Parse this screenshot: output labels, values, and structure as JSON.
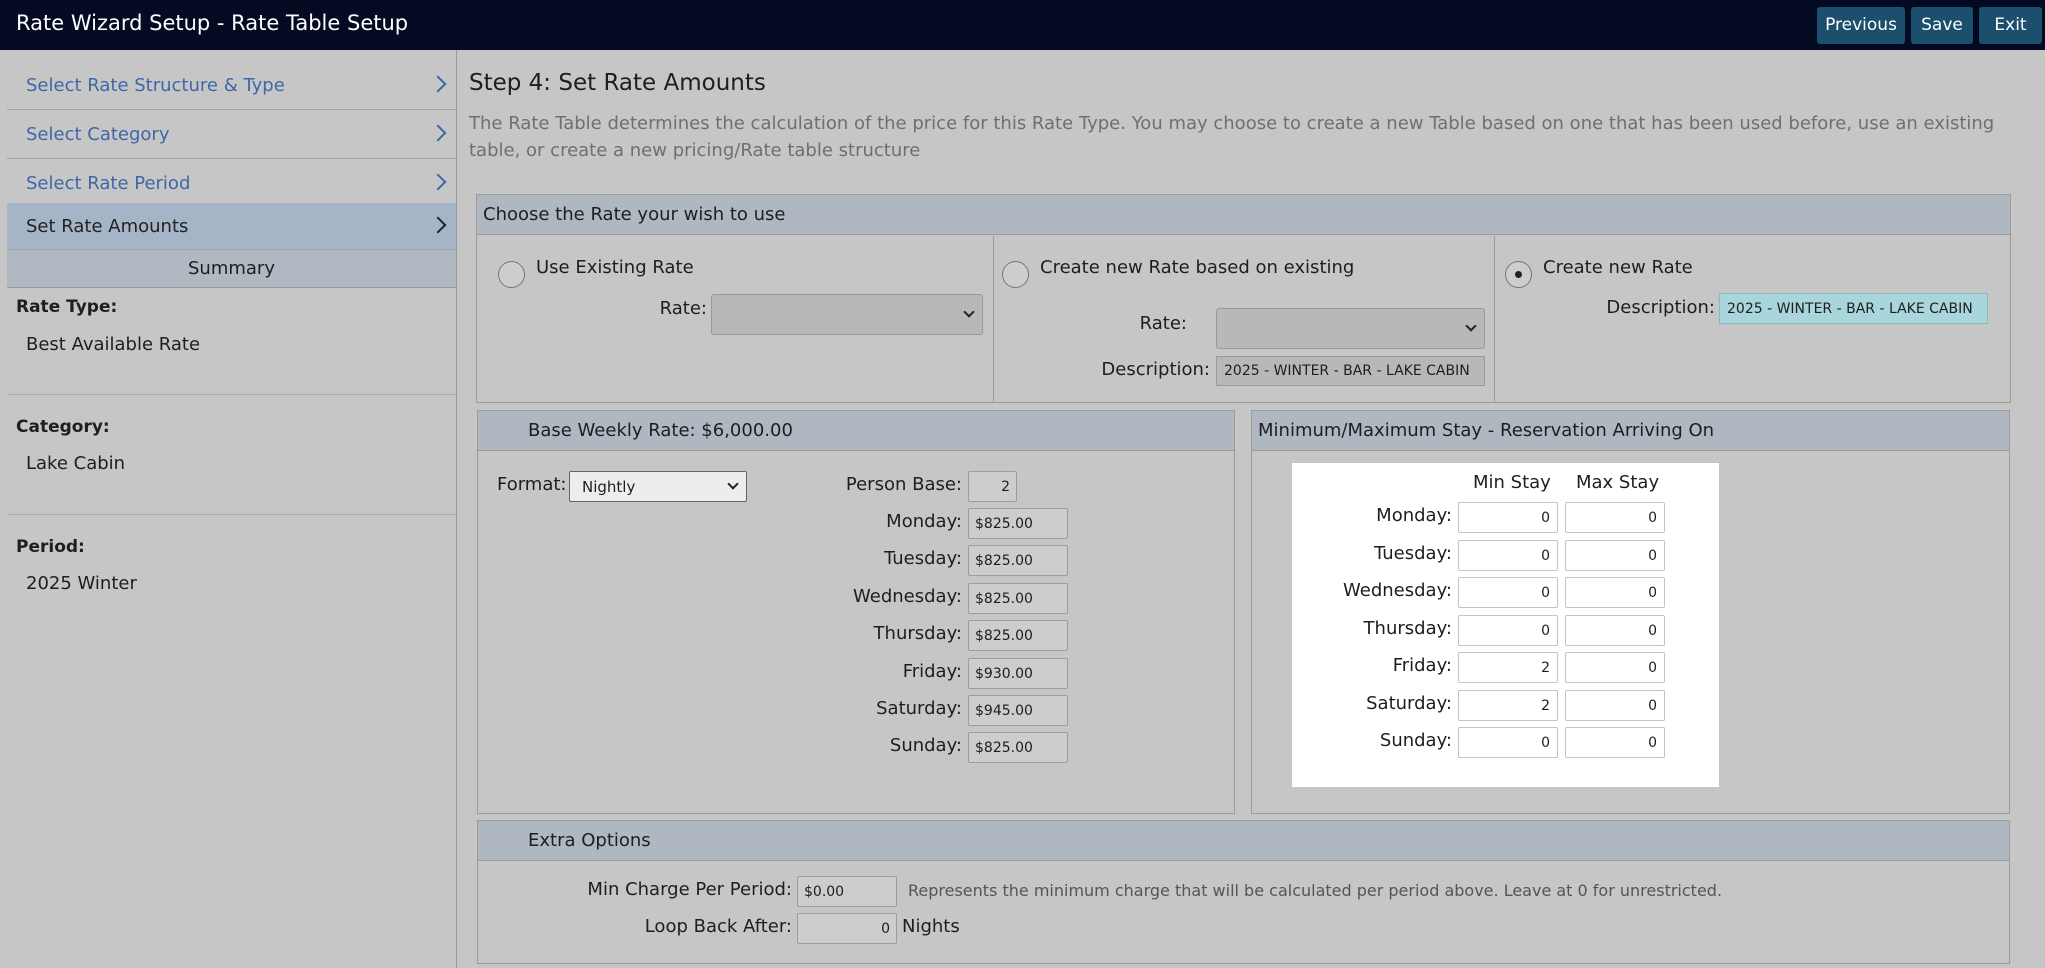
{
  "app": {
    "title": "Rate Wizard Setup - Rate Table Setup",
    "buttons": {
      "previous": "Previous",
      "save": "Save",
      "exit": "Exit"
    },
    "colors": {
      "topbar": "#030a22",
      "button": "#1c4f6e",
      "link": "#3e67a8",
      "active_step": "#a6b4c8",
      "panel_header": "#afb7c1",
      "description_field": "#a9d6dc"
    }
  },
  "sidebar": {
    "steps": [
      {
        "label": "Select Rate Structure & Type",
        "icon": "chevron-right-icon"
      },
      {
        "label": "Select Category",
        "icon": "chevron-right-icon"
      },
      {
        "label": "Select Rate Period",
        "icon": "chevron-right-icon"
      },
      {
        "label": "Set Rate Amounts",
        "icon": "chevron-right-icon",
        "active": true
      }
    ],
    "summary_title": "Summary",
    "rate_type_label": "Rate Type:",
    "rate_type_value": "Best Available Rate",
    "category_label": "Category:",
    "category_value": "Lake Cabin",
    "period_label": "Period:",
    "period_value": "2025 Winter"
  },
  "main": {
    "heading": "Step 4: Set Rate Amounts",
    "intro": "The Rate Table determines the calculation of the price for this Rate Type. You may choose to create a new Table based on one that has been used before, use an existing table, or create a new pricing/Rate table structure"
  },
  "choose_rate": {
    "title": "Choose the Rate your wish to use",
    "use_existing": {
      "label": "Use Existing Rate",
      "rate_label": "Rate:",
      "rate_value": "",
      "selected": false
    },
    "create_based": {
      "label": "Create new Rate based on existing",
      "rate_label": "Rate:",
      "rate_value": "",
      "description_label": "Description:",
      "description_value": "2025 - WINTER - BAR - LAKE CABIN",
      "selected": false
    },
    "create_new": {
      "label": "Create new Rate",
      "description_label": "Description:",
      "description_value": "2025 - WINTER - BAR - LAKE CABIN",
      "selected": true
    }
  },
  "base_rate": {
    "title": "Base Weekly Rate: $6,000.00",
    "format_label": "Format:",
    "format_value": "Nightly",
    "person_base_label": "Person Base:",
    "person_base_value": "2",
    "days": [
      {
        "label": "Monday:",
        "value": "$825.00"
      },
      {
        "label": "Tuesday:",
        "value": "$825.00"
      },
      {
        "label": "Wednesday:",
        "value": "$825.00"
      },
      {
        "label": "Thursday:",
        "value": "$825.00"
      },
      {
        "label": "Friday:",
        "value": "$930.00"
      },
      {
        "label": "Saturday:",
        "value": "$945.00"
      },
      {
        "label": "Sunday:",
        "value": "$825.00"
      }
    ]
  },
  "stay": {
    "title": "Minimum/Maximum Stay - Reservation Arriving On",
    "min_header": "Min Stay",
    "max_header": "Max Stay",
    "rows": [
      {
        "label": "Monday:",
        "min": "0",
        "max": "0"
      },
      {
        "label": "Tuesday:",
        "min": "0",
        "max": "0"
      },
      {
        "label": "Wednesday:",
        "min": "0",
        "max": "0"
      },
      {
        "label": "Thursday:",
        "min": "0",
        "max": "0"
      },
      {
        "label": "Friday:",
        "min": "2",
        "max": "0"
      },
      {
        "label": "Saturday:",
        "min": "2",
        "max": "0"
      },
      {
        "label": "Sunday:",
        "min": "0",
        "max": "0"
      }
    ]
  },
  "extra": {
    "title": "Extra Options",
    "min_charge_label": "Min Charge Per Period:",
    "min_charge_value": "$0.00",
    "min_charge_hint": "Represents the minimum charge that will be calculated per period above. Leave at 0 for unrestricted.",
    "loop_back_label": "Loop Back After:",
    "loop_back_value": "0",
    "loop_back_unit": "Nights"
  }
}
